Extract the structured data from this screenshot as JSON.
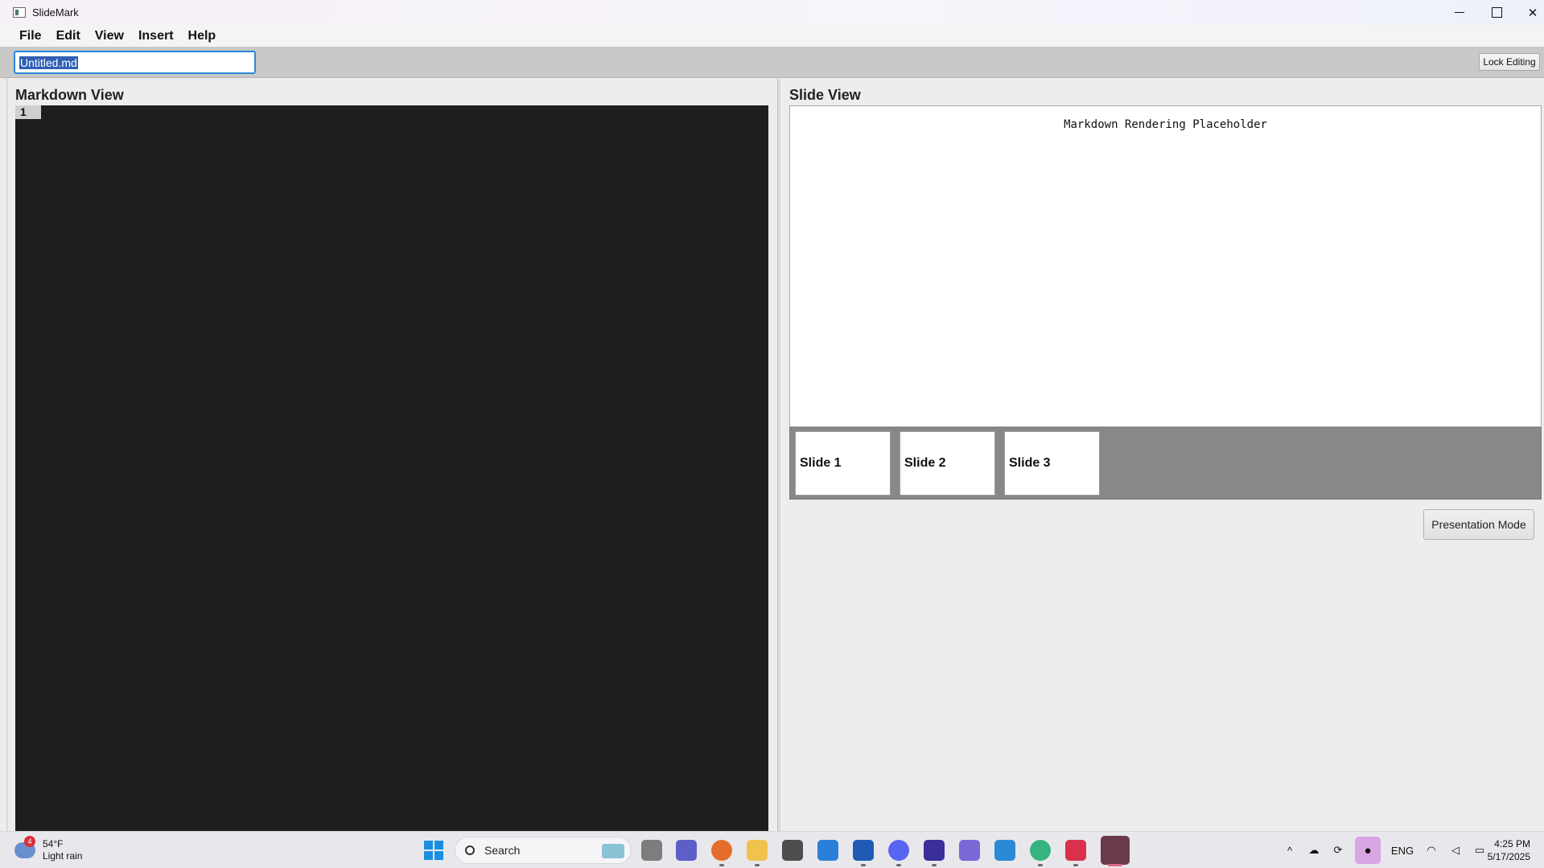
{
  "window": {
    "title": "SlideMark",
    "controls": {
      "minimize": "",
      "maximize": "",
      "close": "✕"
    }
  },
  "menubar": {
    "items": [
      "File",
      "Edit",
      "View",
      "Insert",
      "Help"
    ]
  },
  "toolbar": {
    "filename_value": "Untitled.md",
    "lock_label": "Lock Editing"
  },
  "markdown_view": {
    "title": "Markdown View",
    "line_number": "1"
  },
  "slide_view": {
    "title": "Slide View",
    "render_text": "Markdown Rendering Placeholder",
    "thumbnails": [
      "Slide 1",
      "Slide 2",
      "Slide 3"
    ],
    "presentation_label": "Presentation Mode"
  },
  "taskbar": {
    "weather": {
      "temp": "54°F",
      "condition": "Light rain",
      "badge": "4"
    },
    "search_label": "Search",
    "tray": {
      "language": "ENG",
      "time": "4:25 PM",
      "date": "5/17/2025"
    },
    "pinned_icons": [
      "windows-start-icon",
      "task-view-icon",
      "teams-icon",
      "firefox-icon",
      "file-explorer-icon",
      "app-icon",
      "store-icon",
      "word-icon",
      "discord-icon",
      "intellij-icon",
      "copilot-icon",
      "vscode-icon",
      "slack-icon",
      "jetbrains-toolbox-icon",
      "jetbrains-icon"
    ]
  },
  "colors": {
    "editor_bg": "#1e1e1e",
    "selection": "#2f5fb3",
    "focus_border": "#2e86de",
    "thumb_strip": "#888888"
  }
}
